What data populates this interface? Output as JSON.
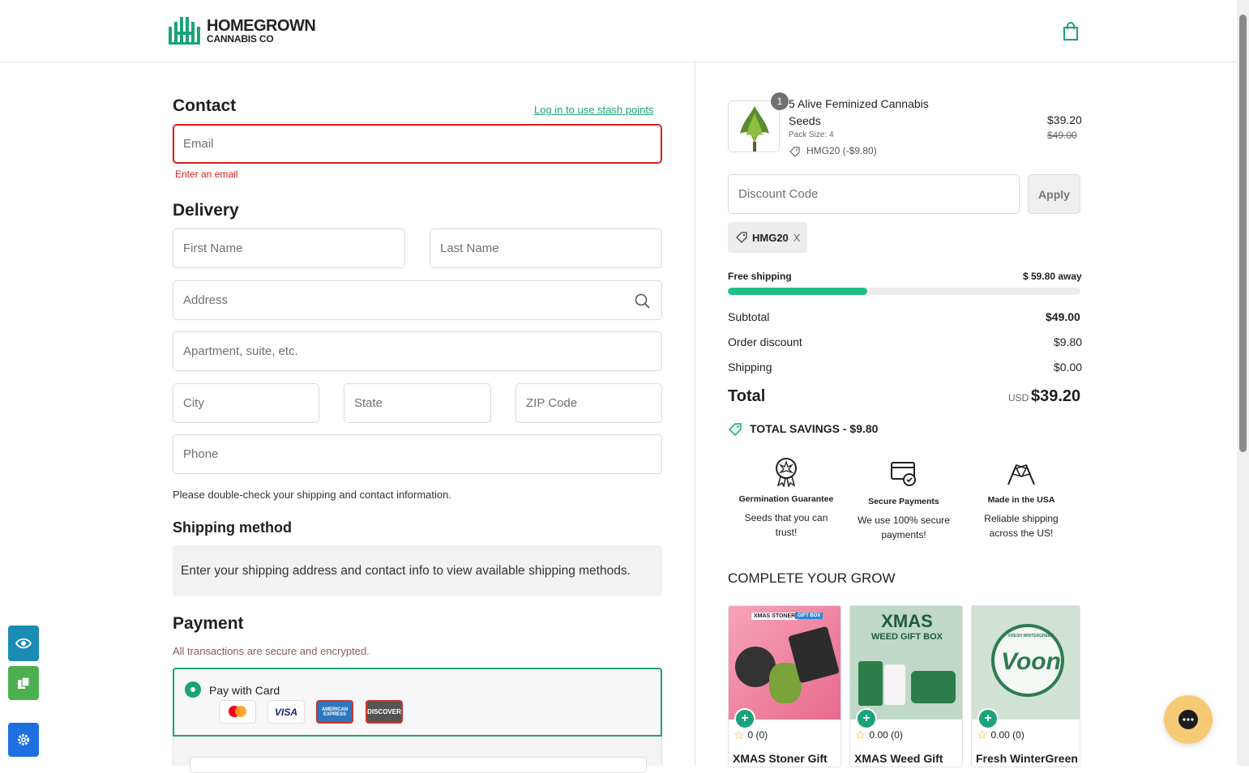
{
  "brand": {
    "line1": "HOMEGROWN",
    "line2": "CANNABIS CO",
    "color": "#1aa37a"
  },
  "contact": {
    "title": "Contact",
    "login_link": "Log in to use stash points",
    "email_placeholder": "Email",
    "email_error": "Enter an email"
  },
  "delivery": {
    "title": "Delivery",
    "first_name": "First Name",
    "last_name": "Last Name",
    "address": "Address",
    "apartment": "Apartment, suite, etc.",
    "city": "City",
    "state": "State",
    "zip": "ZIP Code",
    "phone": "Phone",
    "note": "Please double-check your shipping and contact information."
  },
  "shipping_method": {
    "title": "Shipping method",
    "message": "Enter your shipping address and contact info to view available shipping methods."
  },
  "payment": {
    "title": "Payment",
    "subtitle": "All transactions are secure and encrypted.",
    "option_label": "Pay with Card",
    "cards": [
      "mastercard",
      "VISA",
      "AMERICAN EXPRESS",
      "DISCOVER"
    ]
  },
  "cart": {
    "item": {
      "quantity": "1",
      "name_line1": "5 Alive Feminized Cannabis",
      "name_line2": "Seeds",
      "variant": "Pack Size: 4",
      "discount": "HMG20 (-$9.80)",
      "price": "$39.20",
      "original_price": "$49.00"
    },
    "discount_placeholder": "Discount Code",
    "apply_label": "Apply",
    "applied_code": "HMG20",
    "remove_code": "X",
    "free_shipping_label": "Free shipping",
    "free_shipping_away": "$ 59.80 away",
    "free_shipping_progress": 0.395,
    "subtotal_label": "Subtotal",
    "subtotal_value": "$49.00",
    "order_discount_label": "Order discount",
    "order_discount_value": "$9.80",
    "shipping_label": "Shipping",
    "shipping_value": "$0.00",
    "total_label": "Total",
    "total_currency": "USD",
    "total_value": "$39.20",
    "savings_label": "TOTAL SAVINGS",
    "savings_value": "- $9.80"
  },
  "features": [
    {
      "title": "Germination Guarantee",
      "desc": "Seeds that you can trust!",
      "icon": "award-icon"
    },
    {
      "title": "Secure Payments",
      "desc": "We use 100% secure payments!",
      "icon": "secure-card-icon"
    },
    {
      "title": "Made in the USA",
      "desc": "Reliable shipping across the US!",
      "icon": "flags-icon"
    }
  ],
  "upsell": {
    "title": "COMPLETE YOUR GROW",
    "products": [
      {
        "name": "XMAS Stoner Gift",
        "rating": "0 (0)",
        "badge": "XMAS STONER",
        "badge2": "GIFT BOX"
      },
      {
        "name": "XMAS Weed Gift",
        "rating": "0.00 (0)",
        "badge": "XMAS",
        "badge2": "WEED GIFT BOX"
      },
      {
        "name": "Fresh WinterGreen",
        "rating": "0.00 (0)",
        "badge": "Voon",
        "badge2": "FRESH WINTERGREEN"
      }
    ]
  }
}
